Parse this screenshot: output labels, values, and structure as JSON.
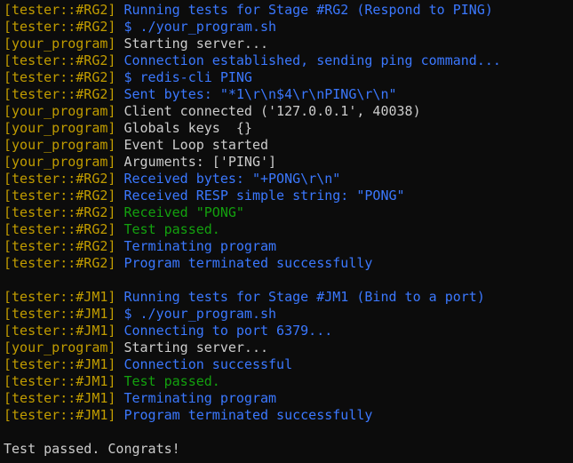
{
  "colors": {
    "background": "#0c0c0c",
    "prefix": "#c19c00",
    "blue": "#3b78ff",
    "white": "#cccccc",
    "green": "#13a10e"
  },
  "lines": [
    {
      "prefix": "[tester::#RG2]",
      "text": "Running tests for Stage #RG2 (Respond to PING)",
      "color": "blue"
    },
    {
      "prefix": "[tester::#RG2]",
      "text": "$ ./your_program.sh",
      "color": "blue"
    },
    {
      "prefix": "[your_program]",
      "text": "Starting server...",
      "color": "white"
    },
    {
      "prefix": "[tester::#RG2]",
      "text": "Connection established, sending ping command...",
      "color": "blue"
    },
    {
      "prefix": "[tester::#RG2]",
      "text": "$ redis-cli PING",
      "color": "blue"
    },
    {
      "prefix": "[tester::#RG2]",
      "text": "Sent bytes: \"*1\\r\\n$4\\r\\nPING\\r\\n\"",
      "color": "blue"
    },
    {
      "prefix": "[your_program]",
      "text": "Client connected ('127.0.0.1', 40038)",
      "color": "white"
    },
    {
      "prefix": "[your_program]",
      "text": "Globals keys  {}",
      "color": "white"
    },
    {
      "prefix": "[your_program]",
      "text": "Event Loop started",
      "color": "white"
    },
    {
      "prefix": "[your_program]",
      "text": "Arguments: ['PING']",
      "color": "white"
    },
    {
      "prefix": "[tester::#RG2]",
      "text": "Received bytes: \"+PONG\\r\\n\"",
      "color": "blue"
    },
    {
      "prefix": "[tester::#RG2]",
      "text": "Received RESP simple string: \"PONG\"",
      "color": "blue"
    },
    {
      "prefix": "[tester::#RG2]",
      "text": "Received \"PONG\"",
      "color": "green"
    },
    {
      "prefix": "[tester::#RG2]",
      "text": "Test passed.",
      "color": "green"
    },
    {
      "prefix": "[tester::#RG2]",
      "text": "Terminating program",
      "color": "blue"
    },
    {
      "prefix": "[tester::#RG2]",
      "text": "Program terminated successfully",
      "color": "blue"
    },
    {
      "prefix": "",
      "text": "",
      "color": "white"
    },
    {
      "prefix": "[tester::#JM1]",
      "text": "Running tests for Stage #JM1 (Bind to a port)",
      "color": "blue"
    },
    {
      "prefix": "[tester::#JM1]",
      "text": "$ ./your_program.sh",
      "color": "blue"
    },
    {
      "prefix": "[tester::#JM1]",
      "text": "Connecting to port 6379...",
      "color": "blue"
    },
    {
      "prefix": "[your_program]",
      "text": "Starting server...",
      "color": "white"
    },
    {
      "prefix": "[tester::#JM1]",
      "text": "Connection successful",
      "color": "blue"
    },
    {
      "prefix": "[tester::#JM1]",
      "text": "Test passed.",
      "color": "green"
    },
    {
      "prefix": "[tester::#JM1]",
      "text": "Terminating program",
      "color": "blue"
    },
    {
      "prefix": "[tester::#JM1]",
      "text": "Program terminated successfully",
      "color": "blue"
    },
    {
      "prefix": "",
      "text": "",
      "color": "white"
    },
    {
      "prefix": "",
      "text": "Test passed. Congrats!",
      "color": "white"
    }
  ]
}
